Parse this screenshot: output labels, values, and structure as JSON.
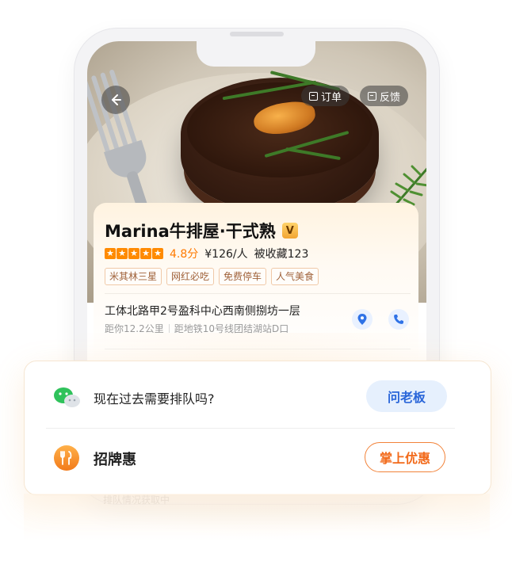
{
  "header": {
    "back_icon": "back-arrow-icon",
    "order_label": "订单",
    "feedback_label": "反馈"
  },
  "restaurant": {
    "name": "Marina牛排屋·干式熟",
    "badge": "V",
    "rating_stars": 5,
    "score": "4.8分",
    "price": "¥126/人",
    "favorites": "被收藏123",
    "tags": [
      "米其林三星",
      "网红必吃",
      "免费停车",
      "人气美食"
    ],
    "address": "工体北路甲2号盈科中心西南侧捌坊一层",
    "distance": "距你12.2公里",
    "metro": "距地铁10号线团结湖站D口"
  },
  "actions": {
    "queue_question": "现在过去需要排队吗?",
    "ask_boss_label": "问老板",
    "signature_deal": "招牌惠",
    "offer_label": "掌上优惠",
    "ghost_text": "排队情况获取中"
  },
  "colors": {
    "accent_orange": "#ff7a00",
    "ask_blue": "#2a66d9",
    "ask_bg": "#e6f0fd",
    "tag_border": "#f0c9a8"
  }
}
